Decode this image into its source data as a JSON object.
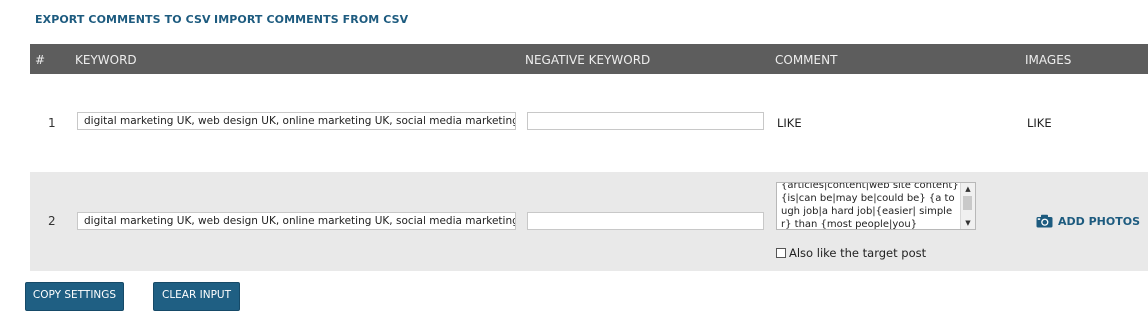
{
  "top_links": {
    "export_label": "EXPORT COMMENTS TO CSV",
    "import_label": "IMPORT COMMENTS FROM CSV"
  },
  "table": {
    "headers": {
      "num": "#",
      "keyword": "KEYWORD",
      "negative_keyword": "NEGATIVE KEYWORD",
      "comment": "COMMENT",
      "images": "IMAGES"
    },
    "rows": [
      {
        "num": "1",
        "keyword": "digital marketing UK, web design UK, online marketing UK, social media marketing UK",
        "negative_keyword": "",
        "comment": "LIKE",
        "images": "LIKE"
      },
      {
        "num": "2",
        "keyword": "digital marketing UK, web design UK, online marketing UK, social media marketing UK",
        "negative_keyword": "",
        "comment": "{articles|content|web site content} {is|can be|may be|could be} {a tough job|a hard job|{easier| simpler} than {most people|you}",
        "also_like_label": "Also like the target post",
        "also_like_checked": false,
        "add_photos_label": "ADD PHOTOS",
        "add_photos_icon": "camera-icon"
      }
    ]
  },
  "buttons": {
    "copy_settings": "COPY SETTINGS",
    "clear_input": "CLEAR INPUT"
  },
  "colors": {
    "accent": "#1f5f83",
    "link": "#1d5b7f",
    "header_bg": "#5d5d5d",
    "alt_row_bg": "#e9e9e9"
  }
}
